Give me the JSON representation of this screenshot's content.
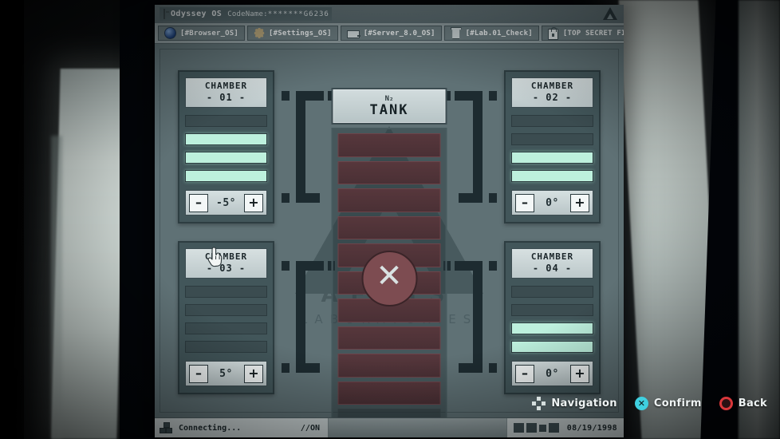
{
  "window": {
    "title": "Odyssey OS",
    "codename_label": "CodeName:",
    "codename_value": "*******G6236",
    "titlebar_icon": "computer-icon",
    "corner_logo": "aegis-triangle-logo"
  },
  "tabs": [
    {
      "label": "[#Browser_OS]",
      "icon": "globe-icon"
    },
    {
      "label": "[#Settings_OS]",
      "icon": "gear-icon"
    },
    {
      "label": "[#Server_8.0_OS]",
      "icon": "server-icon"
    },
    {
      "label": "[#Lab.01_Check]",
      "icon": "lab-door-icon"
    },
    {
      "label": "[TOP SECRET FILES]",
      "icon": "lock-icon"
    }
  ],
  "watermark": {
    "name": "AEGIS",
    "subtitle": "LABORATORIES",
    "logo": "triangle-logo"
  },
  "tank": {
    "subtitle": "N₂",
    "title": "TANK",
    "status_icon": "x-cross-icon",
    "segments_total": 11,
    "segments_filled": 10
  },
  "chambers": [
    {
      "title_line1": "CHAMBER",
      "title_line2": "- 01 -",
      "bars": [
        false,
        true,
        true,
        true
      ],
      "temperature": "-5°",
      "minus_label": "–",
      "plus_label": "+"
    },
    {
      "title_line1": "CHAMBER",
      "title_line2": "- 02 -",
      "bars": [
        false,
        false,
        true,
        true
      ],
      "temperature": "0°",
      "minus_label": "–",
      "plus_label": "+"
    },
    {
      "title_line1": "CHAMBER",
      "title_line2": "- 03 -",
      "bars": [
        false,
        false,
        false,
        false
      ],
      "temperature": "5°",
      "minus_label": "–",
      "plus_label": "+"
    },
    {
      "title_line1": "CHAMBER",
      "title_line2": "- 04 -",
      "bars": [
        false,
        false,
        true,
        true
      ],
      "temperature": "0°",
      "minus_label": "–",
      "plus_label": "+"
    }
  ],
  "statusbar": {
    "connection_icon": "network-icon",
    "connection_text": "Connecting...",
    "connection_state": "//ON",
    "tray_icons": [
      "terminal-icon",
      "network-share-icon",
      "wifi-icon",
      "nodes-icon"
    ],
    "date": "08/19/1998"
  },
  "controls": [
    {
      "button": "dpad-icon",
      "label": "Navigation"
    },
    {
      "button": "x-button-icon",
      "label": "Confirm",
      "glyph": "✕"
    },
    {
      "button": "circle-button-icon",
      "label": "Back"
    }
  ],
  "cursor": {
    "type": "pointing-hand-cursor"
  },
  "colors": {
    "screen_bg": "#5f7175",
    "panel": "#42565a",
    "bar_on": "#bdf0dd",
    "tank_fill": "#57373c",
    "accent_cyan": "#3fd0e0",
    "accent_red": "#d8373a"
  }
}
